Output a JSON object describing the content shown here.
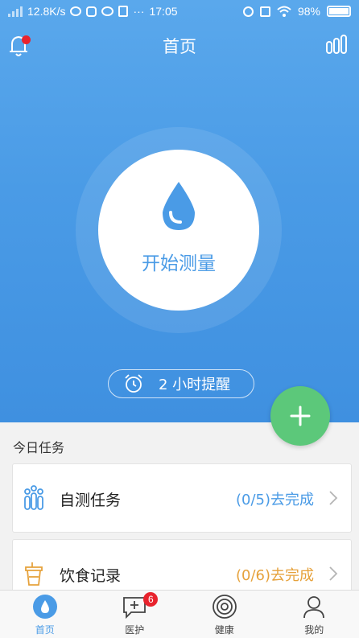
{
  "status_bar": {
    "net_speed": "12.8K/s",
    "extra": "···",
    "time": "17:05",
    "battery": "98%"
  },
  "header": {
    "title": "首页",
    "notification_dot": true
  },
  "hero": {
    "measure_label": "开始测量",
    "reminder_label": "2 小时提醒"
  },
  "fab": {
    "icon": "plus-icon"
  },
  "today": {
    "section_title": "今日任务",
    "tasks": [
      {
        "name": "自测任务",
        "status": "(0/5)去完成",
        "icon": "self-test-icon",
        "status_color": "#4a9be6"
      },
      {
        "name": "饮食记录",
        "status": "(0/6)去完成",
        "icon": "cup-icon",
        "status_color": "#e6a23c"
      }
    ]
  },
  "tabbar": {
    "tabs": [
      {
        "label": "首页",
        "icon": "drop-icon",
        "active": true
      },
      {
        "label": "医护",
        "icon": "chat-plus-icon",
        "badge": "6"
      },
      {
        "label": "健康",
        "icon": "rings-icon"
      },
      {
        "label": "我的",
        "icon": "user-icon"
      }
    ]
  },
  "colors": {
    "primary_blue": "#4a9be6",
    "accent_green": "#5cc87a",
    "alert_red": "#e8232d",
    "status_orange": "#e6a23c"
  }
}
